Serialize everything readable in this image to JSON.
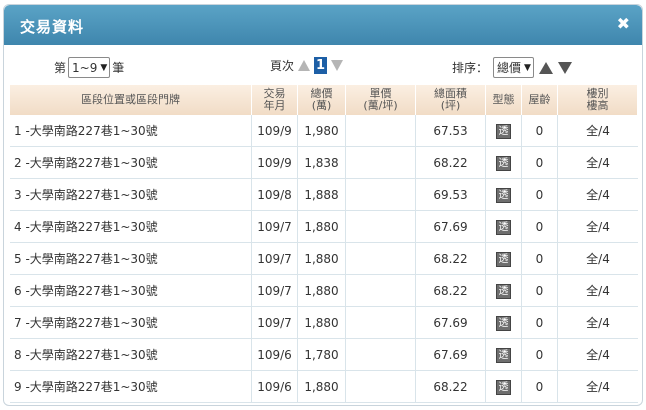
{
  "dialog": {
    "title": "交易資料",
    "close_icon": "close-icon"
  },
  "toolbar": {
    "per_prefix": "第",
    "per_value": "1~9",
    "per_suffix": "筆",
    "page_label": "頁次",
    "page_value": "1",
    "sort_label": "排序：",
    "sort_value": "總價"
  },
  "table": {
    "headers": [
      "區段位置或區段門牌",
      "交易\n年月",
      "總價\n(萬)",
      "單價\n(萬/坪)",
      "總面積\n(坪)",
      "型態",
      "屋齡",
      "樓別\n樓高"
    ],
    "rows": [
      {
        "no": "1",
        "addr": "-大學南路227巷1~30號",
        "date": "109/9",
        "total": "1,980",
        "unit": "",
        "area": "67.53",
        "type": "透",
        "age": "0",
        "floor": "全/4"
      },
      {
        "no": "2",
        "addr": "-大學南路227巷1~30號",
        "date": "109/9",
        "total": "1,838",
        "unit": "",
        "area": "68.22",
        "type": "透",
        "age": "0",
        "floor": "全/4"
      },
      {
        "no": "3",
        "addr": "-大學南路227巷1~30號",
        "date": "109/8",
        "total": "1,888",
        "unit": "",
        "area": "69.53",
        "type": "透",
        "age": "0",
        "floor": "全/4"
      },
      {
        "no": "4",
        "addr": "-大學南路227巷1~30號",
        "date": "109/7",
        "total": "1,880",
        "unit": "",
        "area": "67.69",
        "type": "透",
        "age": "0",
        "floor": "全/4"
      },
      {
        "no": "5",
        "addr": "-大學南路227巷1~30號",
        "date": "109/7",
        "total": "1,880",
        "unit": "",
        "area": "68.22",
        "type": "透",
        "age": "0",
        "floor": "全/4"
      },
      {
        "no": "6",
        "addr": "-大學南路227巷1~30號",
        "date": "109/7",
        "total": "1,880",
        "unit": "",
        "area": "68.22",
        "type": "透",
        "age": "0",
        "floor": "全/4"
      },
      {
        "no": "7",
        "addr": "-大學南路227巷1~30號",
        "date": "109/7",
        "total": "1,880",
        "unit": "",
        "area": "67.69",
        "type": "透",
        "age": "0",
        "floor": "全/4"
      },
      {
        "no": "8",
        "addr": "-大學南路227巷1~30號",
        "date": "109/6",
        "total": "1,780",
        "unit": "",
        "area": "67.69",
        "type": "透",
        "age": "0",
        "floor": "全/4"
      },
      {
        "no": "9",
        "addr": "-大學南路227巷1~30號",
        "date": "109/6",
        "total": "1,880",
        "unit": "",
        "area": "68.22",
        "type": "透",
        "age": "0",
        "floor": "全/4"
      }
    ]
  },
  "colors": {
    "titlebar": "#4a93b9",
    "header_bg": "#f3e2cf",
    "page_highlight": "#1d5fa6"
  }
}
